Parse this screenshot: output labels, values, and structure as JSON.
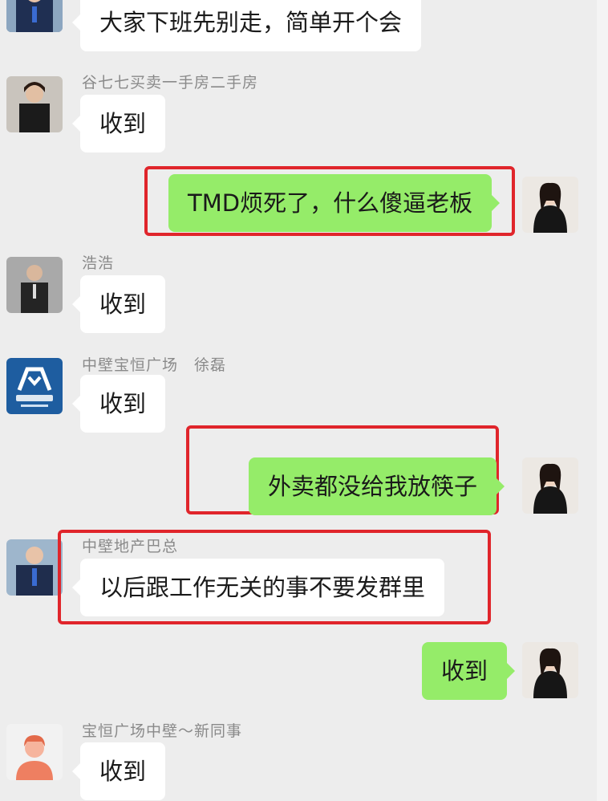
{
  "chat": {
    "messages": [
      {
        "text": "大家下班先别走，简单开个会"
      },
      {
        "sender": "谷七七买卖一手房二手房",
        "text": "收到"
      },
      {
        "text": "TMD烦死了，什么傻逼老板"
      },
      {
        "sender": "浩浩",
        "text": "收到"
      },
      {
        "sender": "中壁宝恒广场　徐磊",
        "text": "收到"
      },
      {
        "text": "外卖都没给我放筷子"
      },
      {
        "sender": "中壁地产巴总",
        "text": "以后跟工作无关的事不要发群里"
      },
      {
        "text": "收到"
      },
      {
        "sender": "宝恒广场中壁～新同事",
        "text": "收到"
      }
    ]
  },
  "colors": {
    "background": "#ededed",
    "incoming_bubble": "#ffffff",
    "outgoing_bubble": "#95ec69",
    "highlight_box": "#e0252b"
  },
  "icons": {
    "company_logo": "zhongbi-logo-icon",
    "placeholder_avatar": "person-placeholder-icon"
  }
}
